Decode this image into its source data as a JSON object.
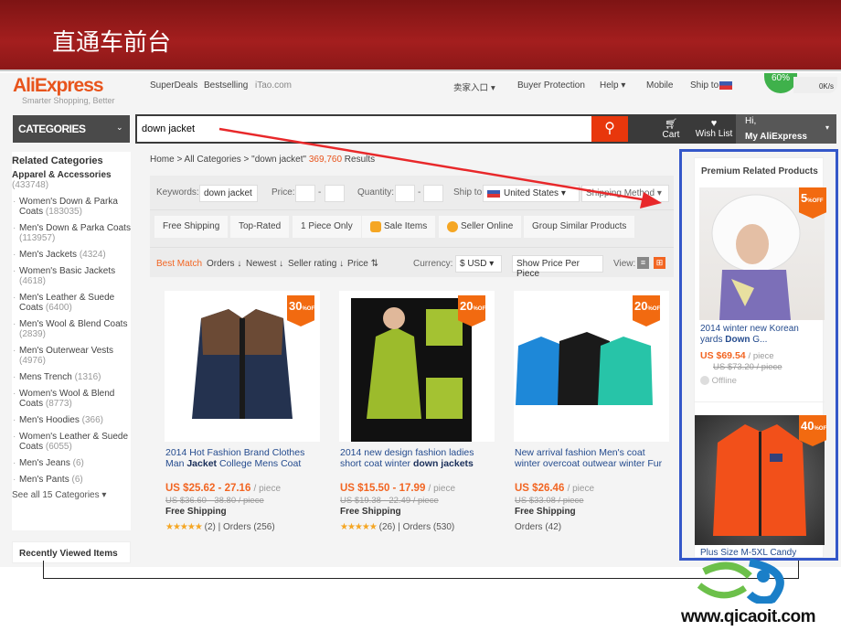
{
  "slide_title": "直通车前台",
  "footer_site": "www.qicaoit.com",
  "header": {
    "logo": "AliExpress",
    "tagline": "Smarter Shopping, Better",
    "links": [
      "SuperDeals",
      "Bestselling",
      "iTao.com"
    ],
    "right_links": [
      "卖家入口 ▾",
      "Buyer Protection",
      "Help ▾",
      "Mobile",
      "Ship to"
    ],
    "speed_percent": "60%",
    "speed_rate": "0K/s",
    "categories_label": "CATEGORIES",
    "search_value": "down jacket",
    "cart_label": "Cart",
    "wishlist_label": "Wish List",
    "greeting": "Hi,",
    "account_label": "My AliExpress"
  },
  "sidebar": {
    "title": "Related Categories",
    "group": "Apparel & Accessories",
    "group_count": "(433748)",
    "items": [
      {
        "label": "Women's Down & Parka Coats",
        "count": "(183035)"
      },
      {
        "label": "Men's Down & Parka Coats",
        "count": "(113957)"
      },
      {
        "label": "Men's Jackets",
        "count": "(4324)"
      },
      {
        "label": "Women's Basic Jackets",
        "count": "(4618)"
      },
      {
        "label": "Men's Leather & Suede Coats",
        "count": "(6400)"
      },
      {
        "label": "Men's Wool & Blend Coats",
        "count": "(2839)"
      },
      {
        "label": "Men's Outerwear Vests",
        "count": "(4976)"
      },
      {
        "label": "Mens Trench",
        "count": "(1316)"
      },
      {
        "label": "Women's Wool & Blend Coats",
        "count": "(8773)"
      },
      {
        "label": "Men's Hoodies",
        "count": "(366)"
      },
      {
        "label": "Women's Leather & Suede Coats",
        "count": "(6055)"
      },
      {
        "label": "Men's Jeans",
        "count": "(6)"
      },
      {
        "label": "Men's Pants",
        "count": "(6)"
      }
    ],
    "see_all": "See all 15 Categories ▾",
    "recently_viewed": "Recently Viewed Items"
  },
  "breadcrumb": {
    "path": "Home > All Categories > \"down jacket\"",
    "count": "369,760",
    "suffix": "Results"
  },
  "filters": {
    "keywords_label": "Keywords:",
    "keywords_value": "down jacket",
    "price_label": "Price:",
    "quantity_label": "Quantity:",
    "ship_to_label": "Ship to",
    "ship_to_value": "United States",
    "shipping_method": "Shipping Method",
    "chips": [
      "Free Shipping",
      "Top-Rated",
      "1 Piece Only",
      "Sale Items",
      "Seller Online",
      "Group Similar Products"
    ],
    "sort": [
      "Best Match",
      "Orders",
      "Newest",
      "Seller rating",
      "Price"
    ],
    "currency_label": "Currency:",
    "currency_value": "$ USD",
    "price_per_piece": "Show Price Per Piece",
    "view_label": "View:"
  },
  "products": [
    {
      "discount": "30",
      "title_pre": "2014 Hot Fashion Brand Clothes Man ",
      "title_bold": "Jacket",
      "title_post": " College Mens Coat",
      "price": "US $25.62 - 27.16",
      "unit": "/ piece",
      "old_price": "US $36.60 - 38.80 / piece",
      "shipping": "Free Shipping",
      "rating": 4.5,
      "stars": "★★★★★",
      "reviews": "(2)",
      "orders": "| Orders (256)"
    },
    {
      "discount": "20",
      "title_pre": "2014 new design fashion ladies short coat winter ",
      "title_bold": "down jackets",
      "title_post": "",
      "price": "US $15.50 - 17.99",
      "unit": "/ piece",
      "old_price": "US $19.38 - 22.49 / piece",
      "shipping": "Free Shipping",
      "rating": 4.8,
      "stars": "★★★★★",
      "reviews": "(26)",
      "orders": "| Orders (530)"
    },
    {
      "discount": "20",
      "title_pre": "New arrival fashion Men's coat winter overcoat outwear winter Fur",
      "title_bold": "",
      "title_post": "",
      "price": "US $26.46",
      "unit": "/ piece",
      "old_price": "US $33.08 / piece",
      "shipping": "Free Shipping",
      "stars": "",
      "reviews": "",
      "orders": "Orders (42)"
    }
  ],
  "premium": {
    "title": "Premium Related Products",
    "items": [
      {
        "discount": "5",
        "title_pre": "2014 winter new Korean yards ",
        "title_bold": "Down",
        "title_post": " G...",
        "price": "US $69.54",
        "unit": "/ piece",
        "old_price": "US $73.20 / piece",
        "status": "Offline"
      },
      {
        "discount": "40",
        "title_pre": "Plus Size M-5XL Candy"
      }
    ]
  },
  "colors": {
    "accent": "#e8541c",
    "highlight_border": "#3457c9",
    "title_bar": "#a41e1e",
    "arrow": "#e8282a"
  }
}
